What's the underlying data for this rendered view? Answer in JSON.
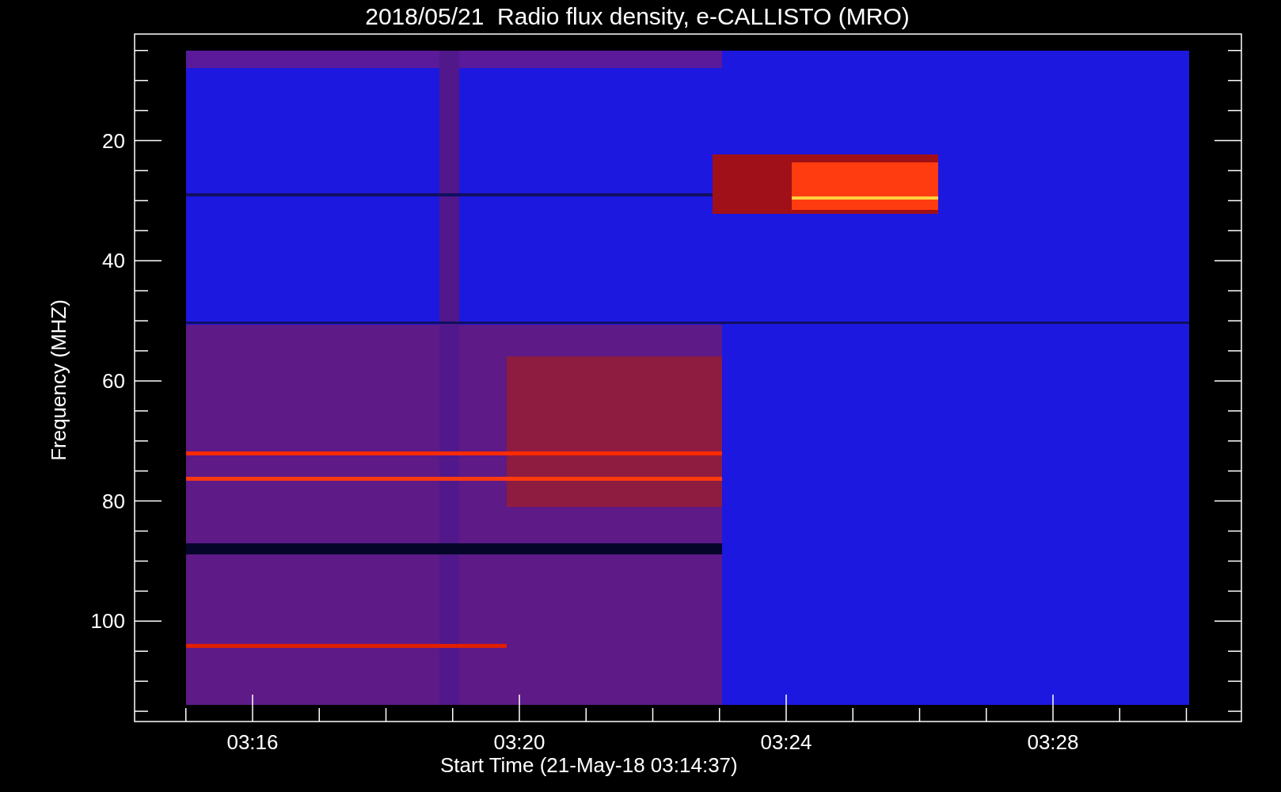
{
  "title": "2018/05/21  Radio flux density, e-CALLISTO (MRO)",
  "plot": {
    "ylabel": "Frequency (MHZ)",
    "xlabel": "Start Time (21-May-18 03:14:37)",
    "yticks": [
      "20",
      "40",
      "60",
      "80",
      "100"
    ],
    "xticks": [
      "03:16",
      "03:20",
      "03:24",
      "03:28"
    ]
  }
}
